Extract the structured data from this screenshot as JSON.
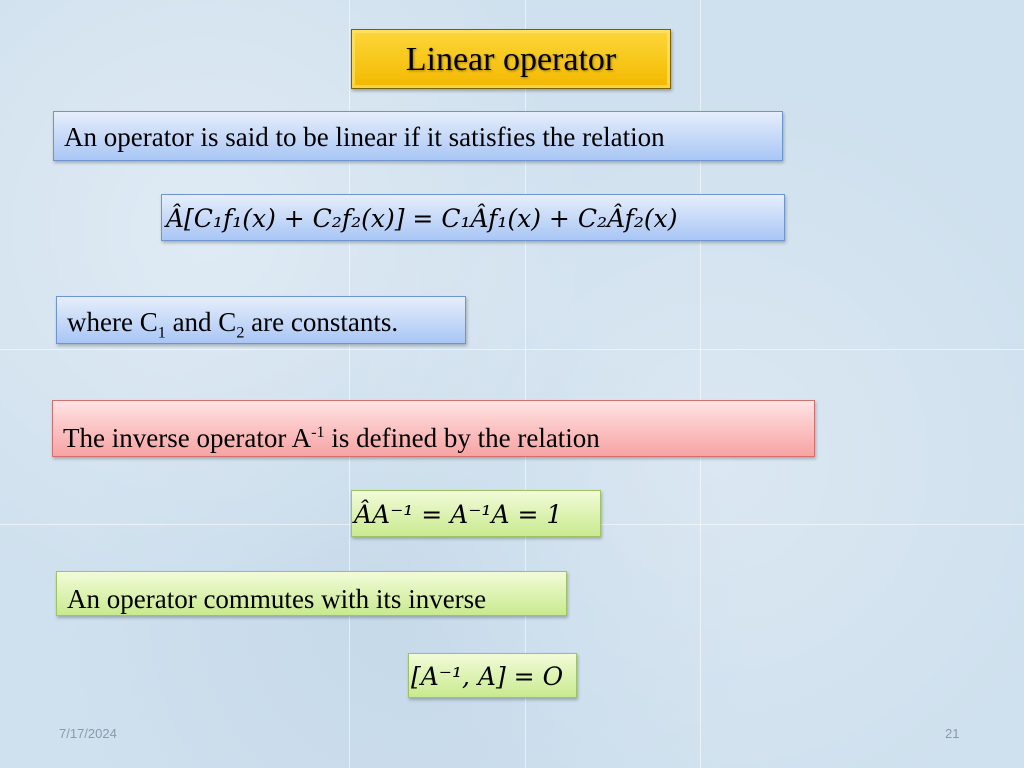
{
  "slide": {
    "title": "Linear operator",
    "statement_linear": "An operator is said to be linear if it satisfies the relation",
    "equation_linear": {
      "lhs": "Â[C₁f₁(x) + C₂f₂(x)]",
      "equals": "=",
      "rhs": "C₁Âf₁(x) + C₂Âf₂(x)"
    },
    "constants_note": {
      "prefix": "where C",
      "sub1": "1",
      "middle": " and C",
      "sub2": "2",
      "suffix": " are constants."
    },
    "inverse_statement": {
      "prefix": "The inverse operator A",
      "sup": "-1",
      "suffix": " is defined by the relation"
    },
    "equation_inverse": "ÂA⁻¹ =  A⁻¹A = 1",
    "commute_statement": "An operator commutes with its inverse",
    "equation_commutator": "[A⁻¹, A] = O"
  },
  "footer": {
    "date": "7/17/2024",
    "page_number": "21"
  },
  "colors": {
    "title_fill": "#f7c417",
    "blue_box": "#a9c6f5",
    "red_box": "#f7a3a3",
    "green_box": "#c9ea8f",
    "background": "#cfe0ee"
  }
}
